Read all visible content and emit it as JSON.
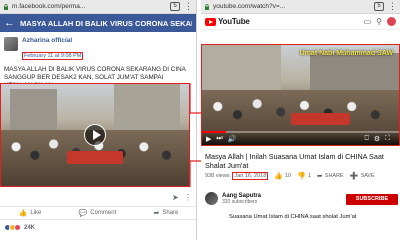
{
  "left": {
    "browser": {
      "url": "m.facebook.com/perma...",
      "tab_count": "5"
    },
    "header": {
      "back_icon": "arrow-left-icon",
      "title": "MASYA ALLAH DI BALIK VIRUS CORONA SEKARANG..."
    },
    "post": {
      "author": "Azharina official",
      "timestamp": "February 11 at 9:08 PM",
      "text": "MASYA ALLAH DI BALIK VIRUS CORONA SEKARANG DI CINA SANGGUP BER DESAK2 KAN, SOLAT JUM'AT SAMPAI KEJALAN JALAN..",
      "actions": {
        "like": "Like",
        "comment": "Comment",
        "share": "Share"
      },
      "reactions_count": "24K"
    }
  },
  "right": {
    "browser": {
      "url": "youtube.com/watch?v=...",
      "tab_count": "5"
    },
    "header": {
      "logo_text": "YouTube"
    },
    "video": {
      "overlay_text": "Umat Nabi Muhammad SAW",
      "progress": 0.12,
      "title": "Masya Allah | Inilah Suasana Umat Islam di CHINA Saat Shalat Jum'at",
      "views": "938 views",
      "date": "Jan 16, 2018",
      "likes": "10",
      "dislikes": "1",
      "share": "SHARE",
      "save": "SAVE"
    },
    "channel": {
      "name": "Aang Saputra",
      "subscribers": "320 subscribers",
      "subscribe": "SUBSCRIBE"
    },
    "description": "Suasana Umat Islam di CHINA saat sholat Jum'at"
  },
  "colors": {
    "facebook_blue": "#3b5998",
    "youtube_red": "#ff0000",
    "highlight_red": "#e02020"
  }
}
